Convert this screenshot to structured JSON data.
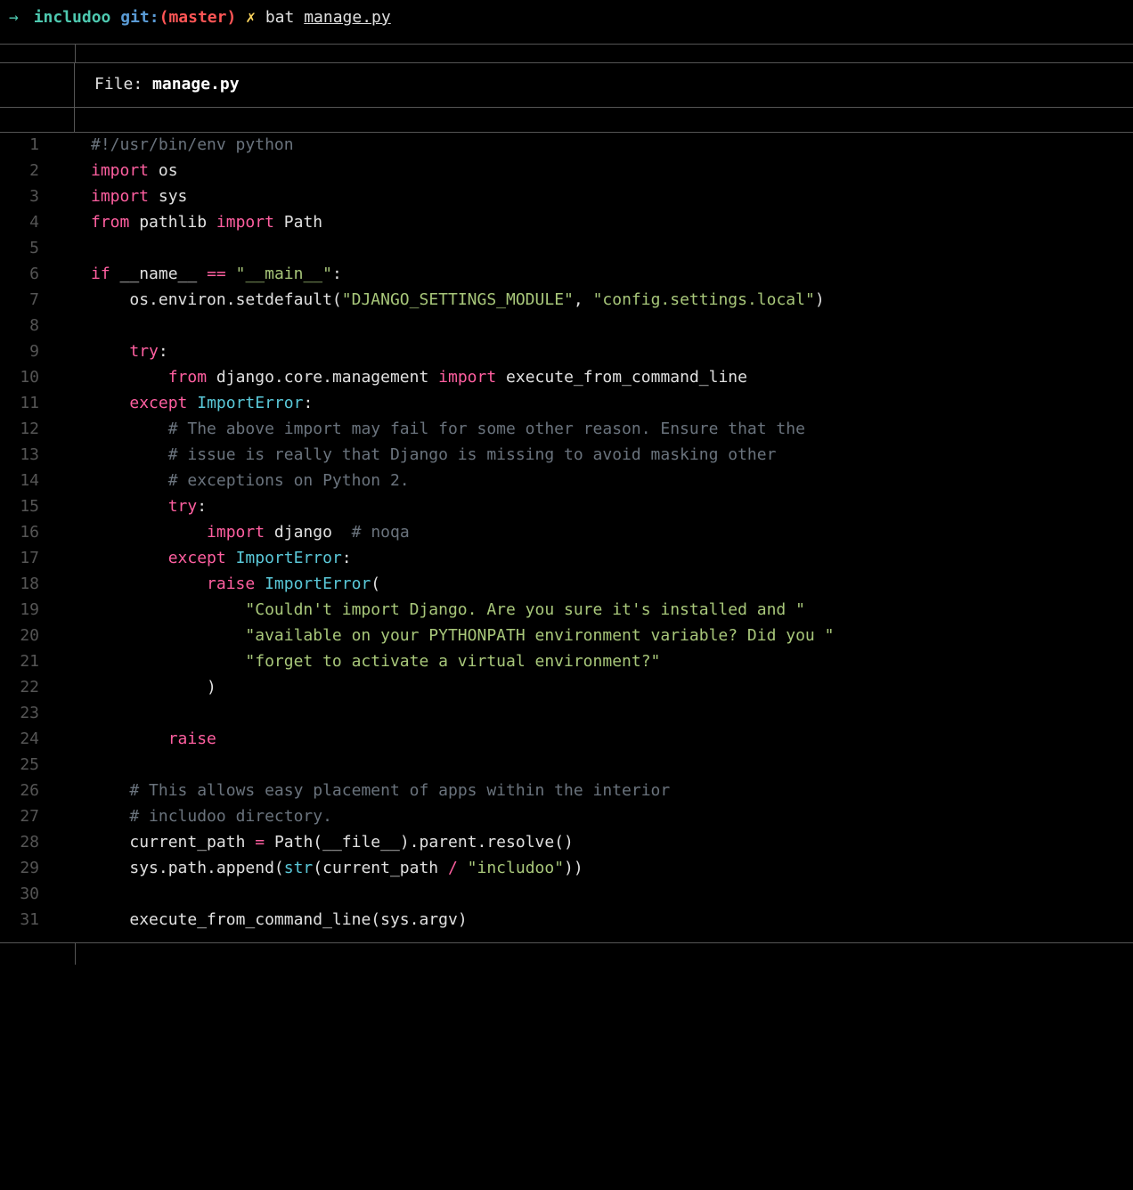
{
  "prompt": {
    "arrow": "→",
    "folder": "includoo",
    "git_label": "git:",
    "paren_open": "(",
    "branch": "master",
    "paren_close": ")",
    "x": "✗",
    "command": "bat",
    "arg": "manage.py"
  },
  "header": {
    "file_label": "File:",
    "file_name": "manage.py"
  },
  "lines": [
    {
      "n": "1",
      "tokens": [
        [
          "c-comment",
          "#!/usr/bin/env python"
        ]
      ]
    },
    {
      "n": "2",
      "tokens": [
        [
          "c-import",
          "import"
        ],
        [
          "",
          " "
        ],
        [
          "c-module",
          "os"
        ]
      ]
    },
    {
      "n": "3",
      "tokens": [
        [
          "c-import",
          "import"
        ],
        [
          "",
          " "
        ],
        [
          "c-module",
          "sys"
        ]
      ]
    },
    {
      "n": "4",
      "tokens": [
        [
          "c-import",
          "from"
        ],
        [
          "",
          " "
        ],
        [
          "c-module",
          "pathlib"
        ],
        [
          "",
          " "
        ],
        [
          "c-import",
          "import"
        ],
        [
          "",
          " "
        ],
        [
          "c-module",
          "Path"
        ]
      ]
    },
    {
      "n": "5",
      "tokens": []
    },
    {
      "n": "6",
      "tokens": [
        [
          "c-keyword",
          "if"
        ],
        [
          "",
          " "
        ],
        [
          "c-name",
          "__name__"
        ],
        [
          "",
          " "
        ],
        [
          "c-op",
          "=="
        ],
        [
          "",
          " "
        ],
        [
          "c-string",
          "\"__main__\""
        ],
        [
          "",
          ":"
        ]
      ]
    },
    {
      "n": "7",
      "tokens": [
        [
          "",
          "    "
        ],
        [
          "c-name",
          "os.environ.setdefault("
        ],
        [
          "c-string",
          "\"DJANGO_SETTINGS_MODULE\""
        ],
        [
          "",
          ", "
        ],
        [
          "c-string",
          "\"config.settings.local\""
        ],
        [
          "",
          ")"
        ]
      ]
    },
    {
      "n": "8",
      "tokens": []
    },
    {
      "n": "9",
      "tokens": [
        [
          "",
          "    "
        ],
        [
          "c-keyword",
          "try"
        ],
        [
          "",
          ":"
        ]
      ]
    },
    {
      "n": "10",
      "tokens": [
        [
          "",
          "        "
        ],
        [
          "c-import",
          "from"
        ],
        [
          "",
          " "
        ],
        [
          "c-module",
          "django.core.management"
        ],
        [
          "",
          " "
        ],
        [
          "c-import",
          "import"
        ],
        [
          "",
          " "
        ],
        [
          "c-module",
          "execute_from_command_line"
        ]
      ]
    },
    {
      "n": "11",
      "tokens": [
        [
          "",
          "    "
        ],
        [
          "c-keyword",
          "except"
        ],
        [
          "",
          " "
        ],
        [
          "c-class",
          "ImportError"
        ],
        [
          "",
          ":"
        ]
      ]
    },
    {
      "n": "12",
      "tokens": [
        [
          "",
          "        "
        ],
        [
          "c-comment",
          "# The above import may fail for some other reason. Ensure that the"
        ]
      ]
    },
    {
      "n": "13",
      "tokens": [
        [
          "",
          "        "
        ],
        [
          "c-comment",
          "# issue is really that Django is missing to avoid masking other"
        ]
      ]
    },
    {
      "n": "14",
      "tokens": [
        [
          "",
          "        "
        ],
        [
          "c-comment",
          "# exceptions on Python 2."
        ]
      ]
    },
    {
      "n": "15",
      "tokens": [
        [
          "",
          "        "
        ],
        [
          "c-keyword",
          "try"
        ],
        [
          "",
          ":"
        ]
      ]
    },
    {
      "n": "16",
      "tokens": [
        [
          "",
          "            "
        ],
        [
          "c-import",
          "import"
        ],
        [
          "",
          " "
        ],
        [
          "c-module",
          "django"
        ],
        [
          "",
          "  "
        ],
        [
          "c-comment",
          "# noqa"
        ]
      ]
    },
    {
      "n": "17",
      "tokens": [
        [
          "",
          "        "
        ],
        [
          "c-keyword",
          "except"
        ],
        [
          "",
          " "
        ],
        [
          "c-class",
          "ImportError"
        ],
        [
          "",
          ":"
        ]
      ]
    },
    {
      "n": "18",
      "tokens": [
        [
          "",
          "            "
        ],
        [
          "c-raise",
          "raise"
        ],
        [
          "",
          " "
        ],
        [
          "c-class",
          "ImportError"
        ],
        [
          "c-paren",
          "("
        ]
      ]
    },
    {
      "n": "19",
      "tokens": [
        [
          "",
          "                "
        ],
        [
          "c-string",
          "\"Couldn't import Django. Are you sure it's installed and \""
        ]
      ]
    },
    {
      "n": "20",
      "tokens": [
        [
          "",
          "                "
        ],
        [
          "c-string",
          "\"available on your PYTHONPATH environment variable? Did you \""
        ]
      ]
    },
    {
      "n": "21",
      "tokens": [
        [
          "",
          "                "
        ],
        [
          "c-string",
          "\"forget to activate a virtual environment?\""
        ]
      ]
    },
    {
      "n": "22",
      "tokens": [
        [
          "",
          "            "
        ],
        [
          "c-paren",
          ")"
        ]
      ]
    },
    {
      "n": "23",
      "tokens": []
    },
    {
      "n": "24",
      "tokens": [
        [
          "",
          "        "
        ],
        [
          "c-raise",
          "raise"
        ]
      ]
    },
    {
      "n": "25",
      "tokens": []
    },
    {
      "n": "26",
      "tokens": [
        [
          "",
          "    "
        ],
        [
          "c-comment",
          "# This allows easy placement of apps within the interior"
        ]
      ]
    },
    {
      "n": "27",
      "tokens": [
        [
          "",
          "    "
        ],
        [
          "c-comment",
          "# includoo directory."
        ]
      ]
    },
    {
      "n": "28",
      "tokens": [
        [
          "",
          "    "
        ],
        [
          "c-name",
          "current_path "
        ],
        [
          "c-op",
          "="
        ],
        [
          "",
          " "
        ],
        [
          "c-name",
          "Path(__file__).parent.resolve()"
        ]
      ]
    },
    {
      "n": "29",
      "tokens": [
        [
          "",
          "    "
        ],
        [
          "c-name",
          "sys.path.append("
        ],
        [
          "c-builtin",
          "str"
        ],
        [
          "c-name",
          "(current_path "
        ],
        [
          "c-op",
          "/"
        ],
        [
          "",
          " "
        ],
        [
          "c-string",
          "\"includoo\""
        ],
        [
          "c-name",
          "))"
        ]
      ]
    },
    {
      "n": "30",
      "tokens": []
    },
    {
      "n": "31",
      "tokens": [
        [
          "",
          "    "
        ],
        [
          "c-name",
          "execute_from_command_line(sys.argv)"
        ]
      ]
    }
  ]
}
